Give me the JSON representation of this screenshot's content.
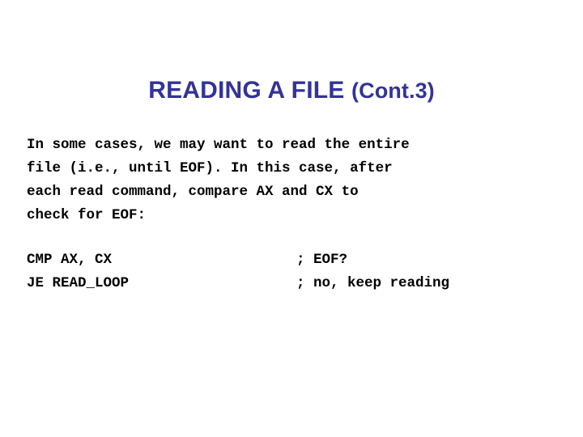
{
  "slide": {
    "background_color": "#ffffff",
    "title": {
      "main": "READING A FILE ",
      "suffix": "(Cont.3)",
      "color": "#333399"
    },
    "body_paragraph": {
      "text_color": "#000000",
      "lines": [
        "In some cases, we may want to read the entire",
        "file (i.e., until EOF). In this case, after",
        "each read command, compare AX and CX to",
        "check for EOF:"
      ]
    },
    "code_block": {
      "text_color": "#000000",
      "rows": [
        {
          "instruction": "CMP AX, CX",
          "comment": "; EOF?"
        },
        {
          "instruction": "JE READ_LOOP",
          "comment": "; no, keep reading"
        }
      ]
    }
  }
}
